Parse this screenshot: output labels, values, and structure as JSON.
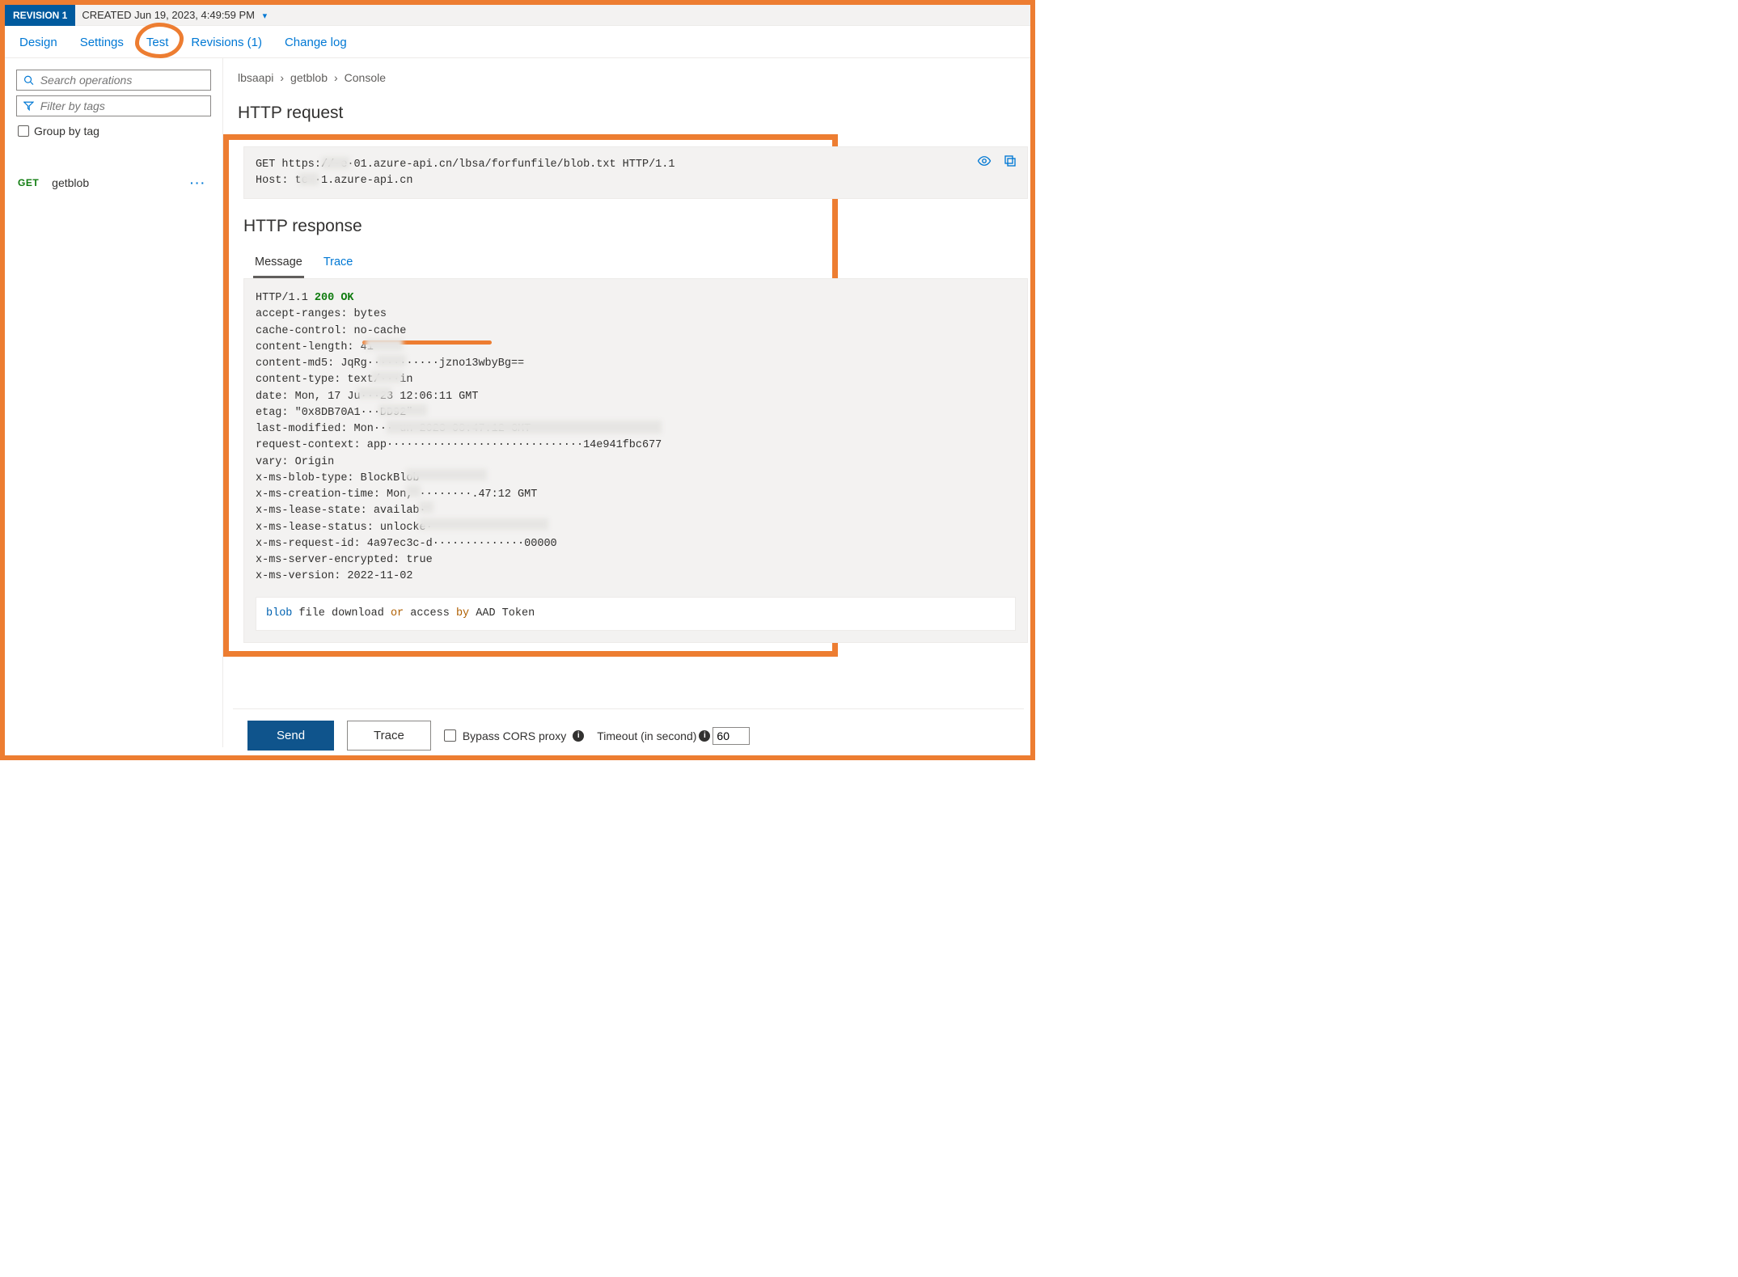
{
  "revision": {
    "badge": "REVISION 1",
    "created": "CREATED Jun 19, 2023, 4:49:59 PM"
  },
  "tabs": {
    "design": "Design",
    "settings": "Settings",
    "test": "Test",
    "revisions": "Revisions (1)",
    "changelog": "Change log"
  },
  "sidebar": {
    "search_placeholder": "Search operations",
    "filter_placeholder": "Filter by tags",
    "group_label": "Group by tag",
    "operation": {
      "method": "GET",
      "name": "getblob"
    }
  },
  "breadcrumbs": {
    "a": "lbsaapi",
    "b": "getblob",
    "c": "Console"
  },
  "section_request": "HTTP request",
  "section_response": "HTTP response",
  "request_text": "GET https://·e·01.azure-api.cn/lbsa/forfunfile/blob.txt HTTP/1.1\nHost: te··1.azure-api.cn",
  "response_tabs": {
    "message": "Message",
    "trace": "Trace"
  },
  "response": {
    "proto": "HTTP/1.1 ",
    "status": "200 OK",
    "headers": "accept-ranges: bytes\ncache-control: no-cache\ncontent-length: 41\ncontent-md5: JqRg···········jzno13wbyBg==\ncontent-type: text/···in\ndate: Mon, 17 Ju···23 12:06:11 GMT\netag: \"0x8DB70A1···DD92\"\nlast-modified: Mon····un 2023 08:47:12 GMT\nrequest-context: app······························14e941fbc677\nvary: Origin\nx-ms-blob-type: BlockBlob\nx-ms-creation-time: Mon, ········.47:12 GMT\nx-ms-lease-state: availab·\nx-ms-lease-status: unlocke·\nx-ms-request-id: 4a97ec3c-d··············00000\nx-ms-server-encrypted: true\nx-ms-version: 2022-11-02",
    "body_tokens": {
      "t1": "blob",
      "t2": " file download ",
      "t3": "or",
      "t4": " access ",
      "t5": "by",
      "t6": " AAD Token"
    }
  },
  "footer": {
    "send": "Send",
    "trace": "Trace",
    "bypass": "Bypass CORS proxy",
    "timeout_label": "Timeout (in second)",
    "timeout_value": "60"
  }
}
